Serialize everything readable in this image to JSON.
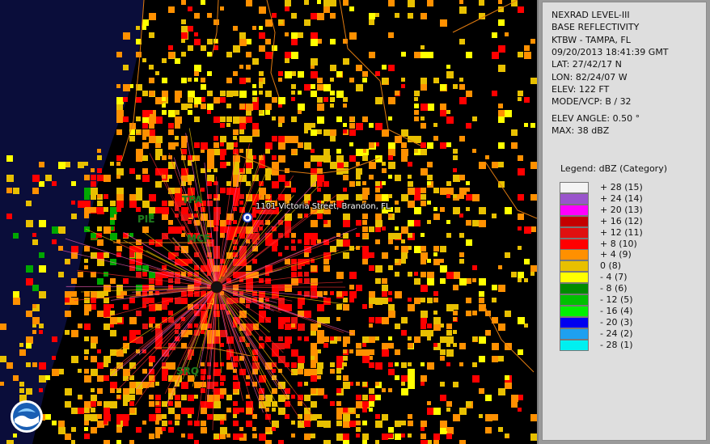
{
  "panel": {
    "lines_top": [
      "NEXRAD LEVEL-III",
      "BASE REFLECTIVITY",
      "KTBW - TAMPA, FL",
      "09/20/2013 18:41:39 GMT",
      "LAT: 27/42/17 N",
      "LON: 82/24/07 W",
      "ELEV: 122 FT",
      "MODE/VCP: B / 32"
    ],
    "lines_bottom": [
      "ELEV ANGLE: 0.50 °",
      "MAX: 38 dBZ"
    ]
  },
  "legend": {
    "title": "Legend: dBZ (Category)",
    "items": [
      {
        "label": "+ 28  (15)",
        "color": "#f4f4f4"
      },
      {
        "label": "+ 24  (14)",
        "color": "#9a55cc"
      },
      {
        "label": "+ 20  (13)",
        "color": "#ff00ff"
      },
      {
        "label": "+ 16  (12)",
        "color": "#c40000"
      },
      {
        "label": "+ 12  (11)",
        "color": "#e01010"
      },
      {
        "label": "+ 8  (10)",
        "color": "#ff0000"
      },
      {
        "label": "+ 4  (9)",
        "color": "#ff9000"
      },
      {
        "label": "0  (8)",
        "color": "#e8c000"
      },
      {
        "label": "- 4  (7)",
        "color": "#ffff00"
      },
      {
        "label": "- 8  (6)",
        "color": "#008c00"
      },
      {
        "label": "- 12  (5)",
        "color": "#00c000"
      },
      {
        "label": "- 16  (4)",
        "color": "#00f000"
      },
      {
        "label": "- 20  (3)",
        "color": "#0000f0"
      },
      {
        "label": "- 24  (2)",
        "color": "#1ea0f0"
      },
      {
        "label": "- 28  (1)",
        "color": "#00f0f0"
      }
    ]
  },
  "map": {
    "cities": [
      {
        "code": "TPA"
      },
      {
        "code": "PIE"
      },
      {
        "code": "MCF"
      },
      {
        "code": "SRQ"
      }
    ],
    "address": "1101 Victoria Street, Brandon, FL",
    "logo": "noaa-logo-icon"
  }
}
